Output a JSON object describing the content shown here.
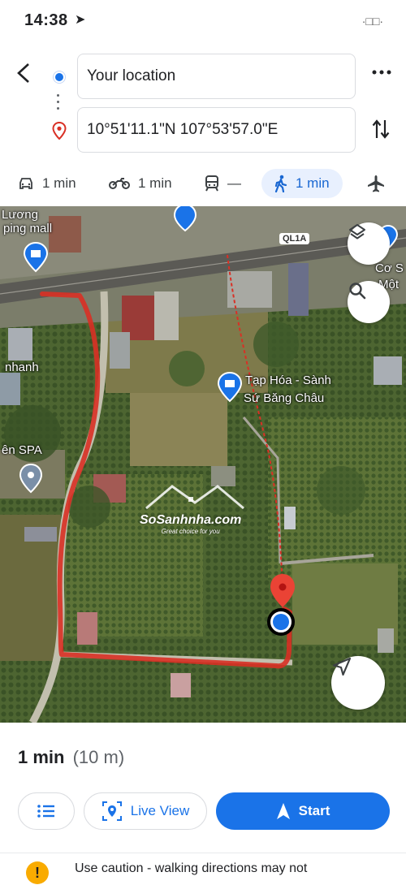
{
  "status": {
    "time": "14:38",
    "nav_arrow": "➤",
    "right": "·□□·"
  },
  "header": {
    "from": "Your location",
    "to": "10°51'11.1\"N 107°53'57.0\"E"
  },
  "modes": [
    {
      "icon": "car-icon",
      "label": "1 min"
    },
    {
      "icon": "motorbike-icon",
      "label": "1 min"
    },
    {
      "icon": "transit-icon",
      "label": "—"
    },
    {
      "icon": "walk-icon",
      "label": "1 min"
    },
    {
      "icon": "flight-icon",
      "label": ""
    }
  ],
  "map": {
    "labels": {
      "top_left_1": "Lương",
      "top_left_2": "ping mall",
      "nhanh": "nhanh",
      "spa": "ên SPA",
      "store_1": "Tạp Hóa - Sành",
      "store_2": "Sứ Băng Châu",
      "right_1": "Cơ S",
      "right_2": "Một"
    },
    "road_tag": "QL1A",
    "watermark_title": "SoSanhnha.com",
    "watermark_sub": "Great choice for you",
    "colors": {
      "route": "#d93025",
      "dest_pin": "#ea4335",
      "origin": "#1a73e8"
    }
  },
  "bottom": {
    "eta_time": "1 min",
    "eta_dist": "(10 m)",
    "live_view": "Live View",
    "start": "Start",
    "warning": "Use caution - walking directions may not"
  }
}
